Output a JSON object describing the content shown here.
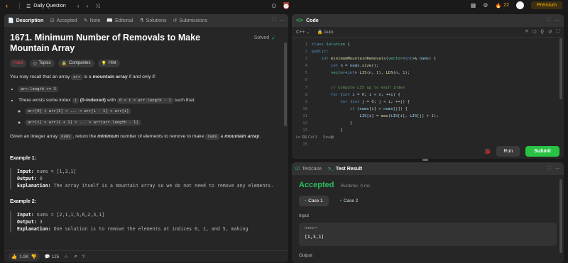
{
  "topbar": {
    "title": "Daily Question",
    "streak": "22",
    "premium": "Premium"
  },
  "left_tabs": [
    "Description",
    "Accepted",
    "Note",
    "Editorial",
    "Solutions",
    "Submissions"
  ],
  "problem": {
    "title": "1671. Minimum Number of Removals to Make Mountain Array",
    "solved": "Solved",
    "tags": [
      "Hard",
      "Topics",
      "Companies",
      "Hint"
    ],
    "p1a": "You may recall that an array ",
    "p1code": "arr",
    "p1b": " is a ",
    "p1bold": "mountain array",
    "p1c": " if and only if:",
    "b1": "arr.length >= 3",
    "b2a": "There exists some index ",
    "b2code": "i",
    "b2bold": "(0-indexed)",
    "b2b": " with ",
    "b2code2": "0 < i < arr.length - 1",
    "b2c": " such that:",
    "b3": "arr[0] < arr[1] < ... < arr[i - 1] < arr[i]",
    "b4": "arr[i] > arr[i + 1] > ... > arr[arr.length - 1]",
    "p2a": "Given an integer array ",
    "p2code": "nums",
    "p2b": ", return the ",
    "p2em": "minimum",
    "p2c": " number of elements to remove to make ",
    "p2code2": "nums",
    "p2d": " a ",
    "p2em2": "mountain array",
    "p2e": ".",
    "ex1": "Example 1:",
    "ex1_input_l": "Input:",
    "ex1_input": " nums = [1,3,1]",
    "ex1_output_l": "Output:",
    "ex1_output": " 0",
    "ex1_expl_l": "Explanation:",
    "ex1_expl": " The array itself is a mountain array so we do not need to remove any elements.",
    "ex2": "Example 2:",
    "ex2_input_l": "Input:",
    "ex2_input": " nums = [2,1,1,5,6,2,3,1]",
    "ex2_output_l": "Output:",
    "ex2_output": " 3",
    "ex2_expl_l": "Explanation:",
    "ex2_expl": " One solution is to remove the elements at indices 0, 1, and 5, making"
  },
  "bottombar": {
    "likes": "1.9K",
    "comments": "125"
  },
  "code_panel": {
    "title": "Code",
    "lang": "C++",
    "mode": "Auto",
    "status_pos": "Ln 36, Col 3",
    "status_saved": "Saved",
    "run": "Run",
    "submit": "Submit"
  },
  "code_lines": [
    {
      "n": "1"
    },
    {
      "n": "2"
    },
    {
      "n": "3"
    },
    {
      "n": "4"
    },
    {
      "n": "5"
    },
    {
      "n": "6"
    },
    {
      "n": "7"
    },
    {
      "n": "8"
    },
    {
      "n": "9"
    },
    {
      "n": "10"
    },
    {
      "n": "11"
    },
    {
      "n": "12"
    },
    {
      "n": "13"
    },
    {
      "n": "14"
    },
    {
      "n": "15"
    }
  ],
  "test_panel": {
    "tab1": "Testcase",
    "tab2": "Test Result",
    "verdict": "Accepted",
    "runtime": "Runtime: 0 ms",
    "case1": "Case 1",
    "case2": "Case 2",
    "input_label": "Input",
    "var": "nums =",
    "value": "[1,3,1]",
    "output_label": "Output"
  }
}
